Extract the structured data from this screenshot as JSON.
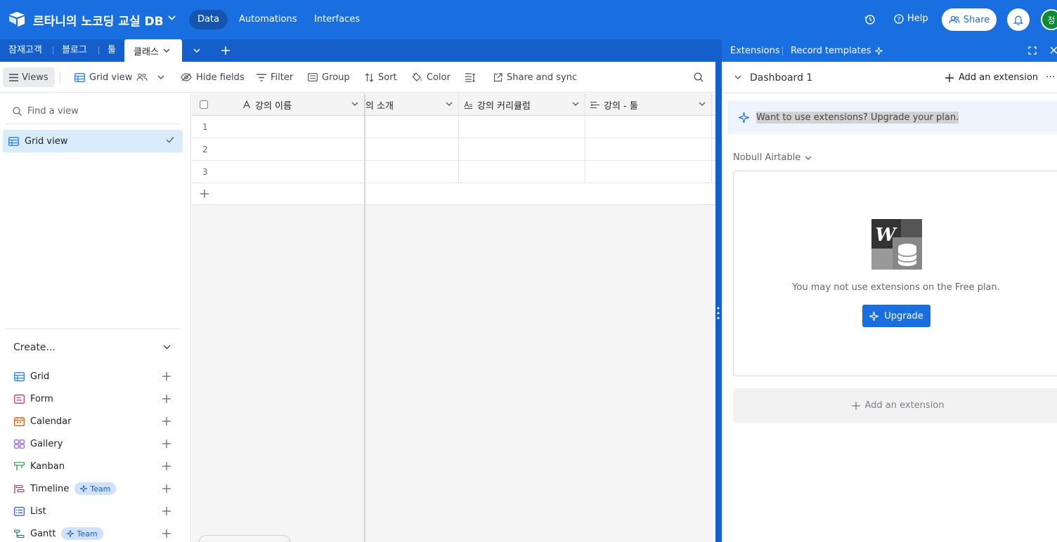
{
  "topbar": {
    "base_title": "르타니의 노코딩 교실 DB",
    "nav": [
      "Data",
      "Automations",
      "Interfaces"
    ],
    "help": "Help",
    "share": "Share",
    "avatar_initial": "정"
  },
  "tabs": {
    "items": [
      "잠재고객",
      "블로그",
      "툴"
    ],
    "active": "클래스"
  },
  "toolbar": {
    "views": "Views",
    "grid_view": "Grid view",
    "hide_fields": "Hide fields",
    "filter": "Filter",
    "group": "Group",
    "sort": "Sort",
    "color": "Color",
    "share_sync": "Share and sync"
  },
  "sidebar": {
    "find_placeholder": "Find a view",
    "active_view": "Grid view",
    "create_label": "Create...",
    "create_items": [
      {
        "label": "Grid",
        "icon": "grid-icon",
        "color": "#2d7ff9"
      },
      {
        "label": "Form",
        "icon": "form-icon",
        "color": "#d6338a"
      },
      {
        "label": "Calendar",
        "icon": "calendar-icon",
        "color": "#e8590c"
      },
      {
        "label": "Gallery",
        "icon": "gallery-icon",
        "color": "#8b5cf6"
      },
      {
        "label": "Kanban",
        "icon": "kanban-icon",
        "color": "#20a34a"
      },
      {
        "label": "Timeline",
        "icon": "timeline-icon",
        "color": "#c2255c",
        "badge": "Team"
      },
      {
        "label": "List",
        "icon": "list-icon",
        "color": "#1d4ed8"
      },
      {
        "label": "Gantt",
        "icon": "gantt-icon",
        "color": "#0f766e",
        "badge": "Team"
      }
    ]
  },
  "grid": {
    "columns": [
      "강의 이름",
      "의 소개",
      "강의 커리큘럼",
      "강의 - 툴"
    ],
    "rows": [
      "1",
      "2",
      "3"
    ]
  },
  "extensions": {
    "tab_extensions": "Extensions",
    "tab_templates": "Record templates",
    "dashboard": "Dashboard 1",
    "add_extension": "Add an extension",
    "banner": "Want to use extensions? Upgrade your plan.",
    "workspace": "Nobull Airtable",
    "card_message": "You may not use extensions on the Free plan.",
    "upgrade": "Upgrade",
    "add_extension_bottom": "Add an extension"
  },
  "colors": {
    "brand_blue": "#1a6fe0",
    "tab_blue": "#155fcc",
    "selected_view": "#d9ecfc"
  }
}
